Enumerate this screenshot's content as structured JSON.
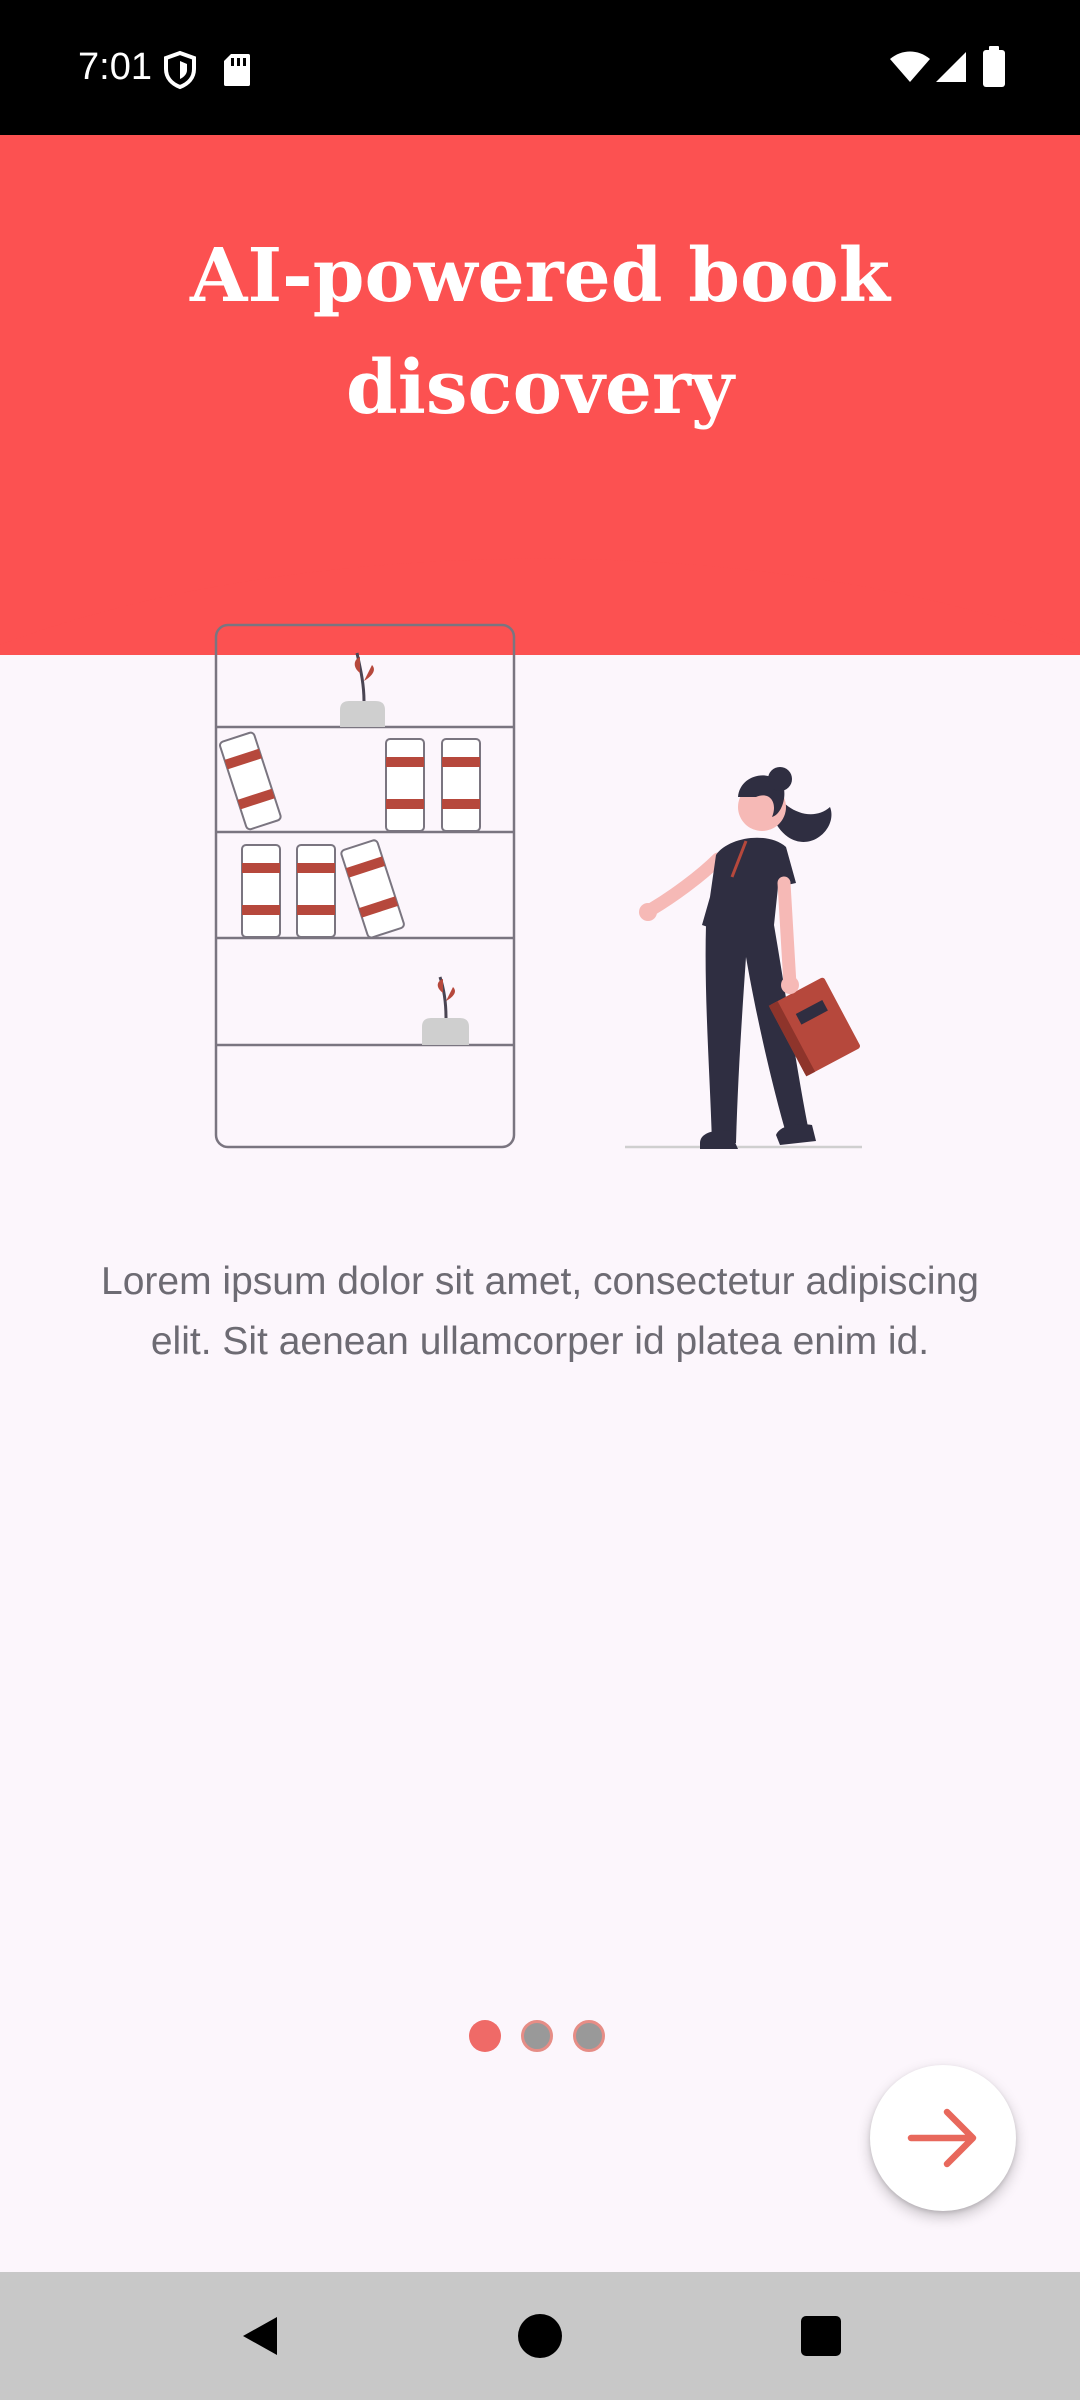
{
  "status_bar": {
    "time": "7:01",
    "left_icons": [
      "shield-icon",
      "sd-card-icon"
    ],
    "right_icons": [
      "wifi-icon",
      "cell-signal-icon",
      "battery-icon"
    ]
  },
  "onboarding": {
    "title": "AI-powered book discovery",
    "description": "Lorem ipsum dolor sit amet, consectetur adipiscing elit. Sit aenean ullamcorper id platea enim id.",
    "page_indicator": {
      "total": 3,
      "current": 1
    },
    "next_button_icon": "arrow-right-icon"
  },
  "navigation_bar": {
    "buttons": [
      "back-icon",
      "home-icon",
      "recents-icon"
    ]
  },
  "colors": {
    "header": "#fc5151",
    "background": "#fcf6fc",
    "accent": "#e8685c",
    "dot_active": "#ef6a67",
    "dot_inactive": "#999999",
    "text": "#6d6b73"
  }
}
